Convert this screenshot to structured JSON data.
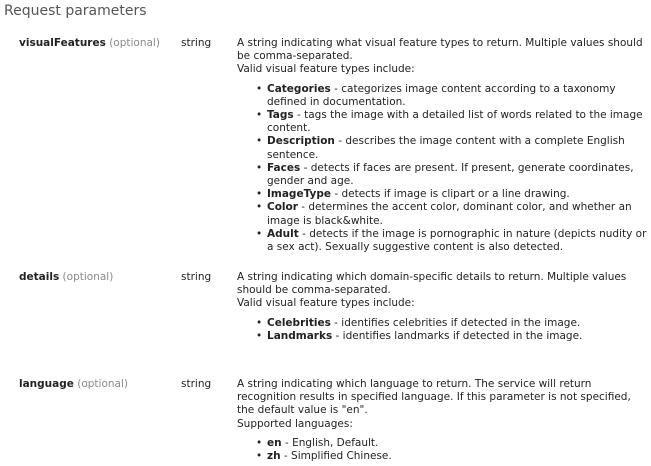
{
  "section_title": "Request parameters",
  "params": [
    {
      "name": "visualFeatures",
      "optional": "(optional)",
      "type": "string",
      "description": "A string indicating what visual feature types to return. Multiple values should be comma-separated.",
      "list_intro": "Valid visual feature types include:",
      "items": [
        {
          "term": "Categories",
          "text": " - categorizes image content according to a taxonomy defined in documentation."
        },
        {
          "term": "Tags",
          "text": " - tags the image with a detailed list of words related to the image content."
        },
        {
          "term": "Description",
          "text": " - describes the image content with a complete English sentence."
        },
        {
          "term": "Faces",
          "text": " - detects if faces are present. If present, generate coordinates, gender and age."
        },
        {
          "term": "ImageType",
          "text": " - detects if image is clipart or a line drawing."
        },
        {
          "term": "Color",
          "text": " - determines the accent color, dominant color, and whether an image is black&white."
        },
        {
          "term": "Adult",
          "text": " - detects if the image is pornographic in nature (depicts nudity or a sex act). Sexually suggestive content is also detected."
        }
      ]
    },
    {
      "name": "details",
      "optional": "(optional)",
      "type": "string",
      "description": "A string indicating which domain-specific details to return. Multiple values should be comma-separated.",
      "list_intro": "Valid visual feature types include:",
      "items": [
        {
          "term": "Celebrities",
          "text": " - identifies celebrities if detected in the image."
        },
        {
          "term": "Landmarks",
          "text": " - identifies landmarks if detected in the image."
        }
      ]
    },
    {
      "name": "language",
      "optional": "(optional)",
      "type": "string",
      "description": "A string indicating which language to return. The service will return recognition results in specified language. If this parameter is not specified, the default value is \"en\".",
      "list_intro": "Supported languages:",
      "items": [
        {
          "term": "en",
          "text": " - English, Default."
        },
        {
          "term": "zh",
          "text": " - Simplified Chinese."
        }
      ]
    }
  ]
}
